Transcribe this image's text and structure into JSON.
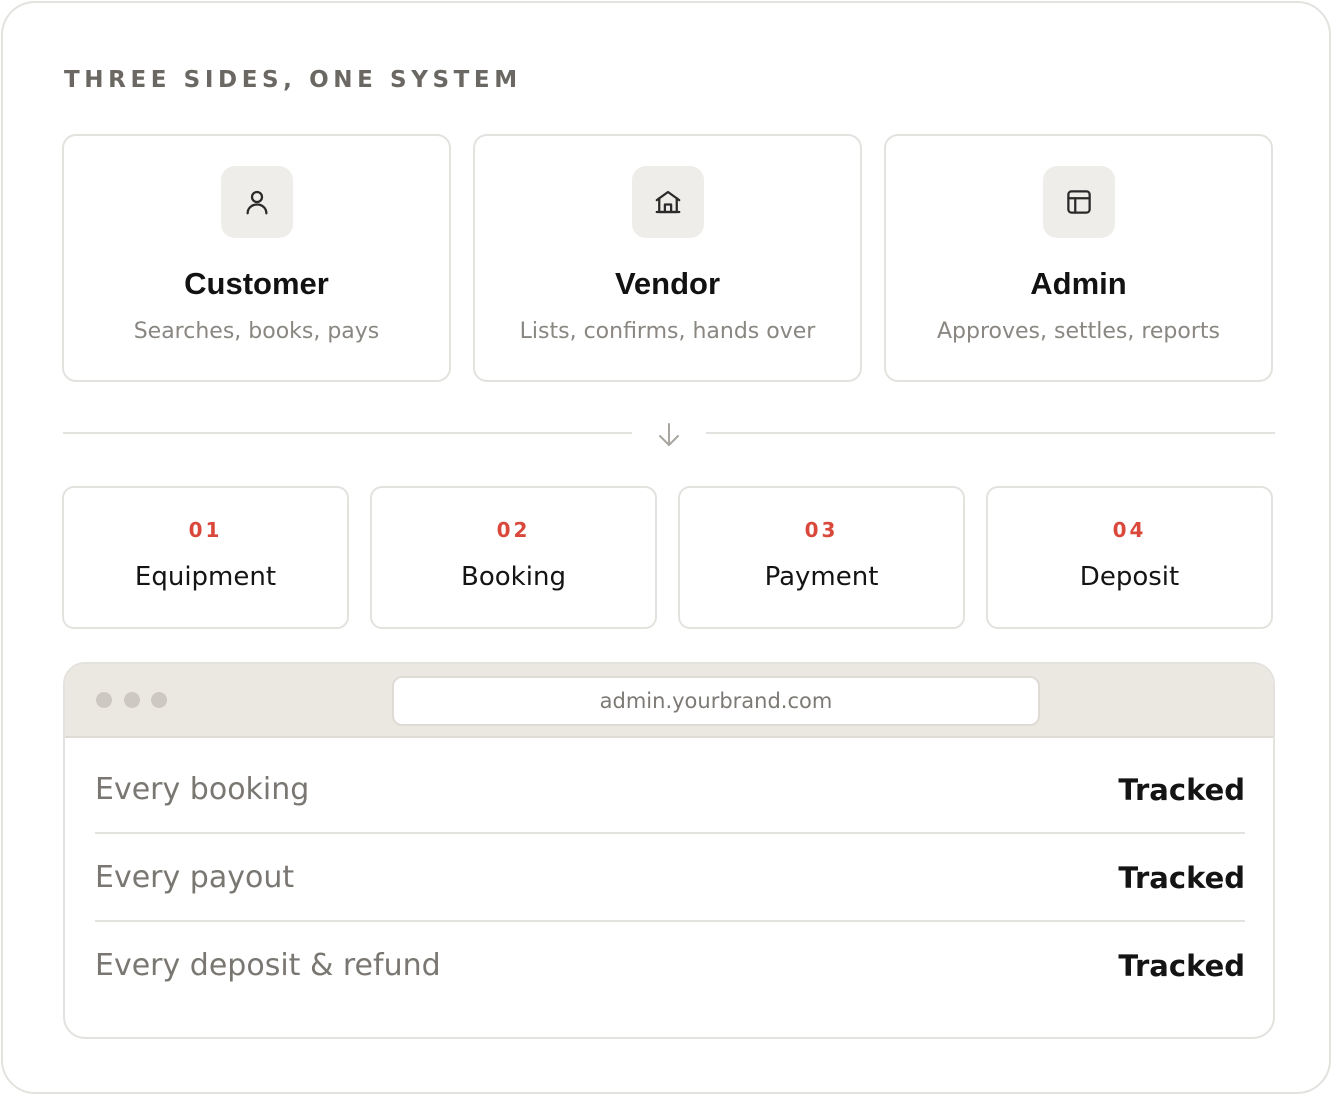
{
  "eyebrow": "THREE SIDES, ONE SYSTEM",
  "roles": [
    {
      "icon": "user-icon",
      "title": "Customer",
      "description": "Searches, books, pays"
    },
    {
      "icon": "storefront-icon",
      "title": "Vendor",
      "description": "Lists, confirms, hands over"
    },
    {
      "icon": "dashboard-layout-icon",
      "title": "Admin",
      "description": "Approves, settles, reports"
    }
  ],
  "divider": {
    "icon": "arrow-down-icon"
  },
  "steps": [
    {
      "number": "01",
      "label": "Equipment"
    },
    {
      "number": "02",
      "label": "Booking"
    },
    {
      "number": "03",
      "label": "Payment"
    },
    {
      "number": "04",
      "label": "Deposit"
    }
  ],
  "browser": {
    "url": "admin.yourbrand.com",
    "rows": [
      {
        "label": "Every booking",
        "status": "Tracked"
      },
      {
        "label": "Every payout",
        "status": "Tracked"
      },
      {
        "label": "Every deposit & refund",
        "status": "Tracked"
      }
    ]
  },
  "colors": {
    "accent": "#d9483b",
    "border": "#e4e2de",
    "icon_bg": "#efede9",
    "browser_bar": "#ebe8e2"
  }
}
